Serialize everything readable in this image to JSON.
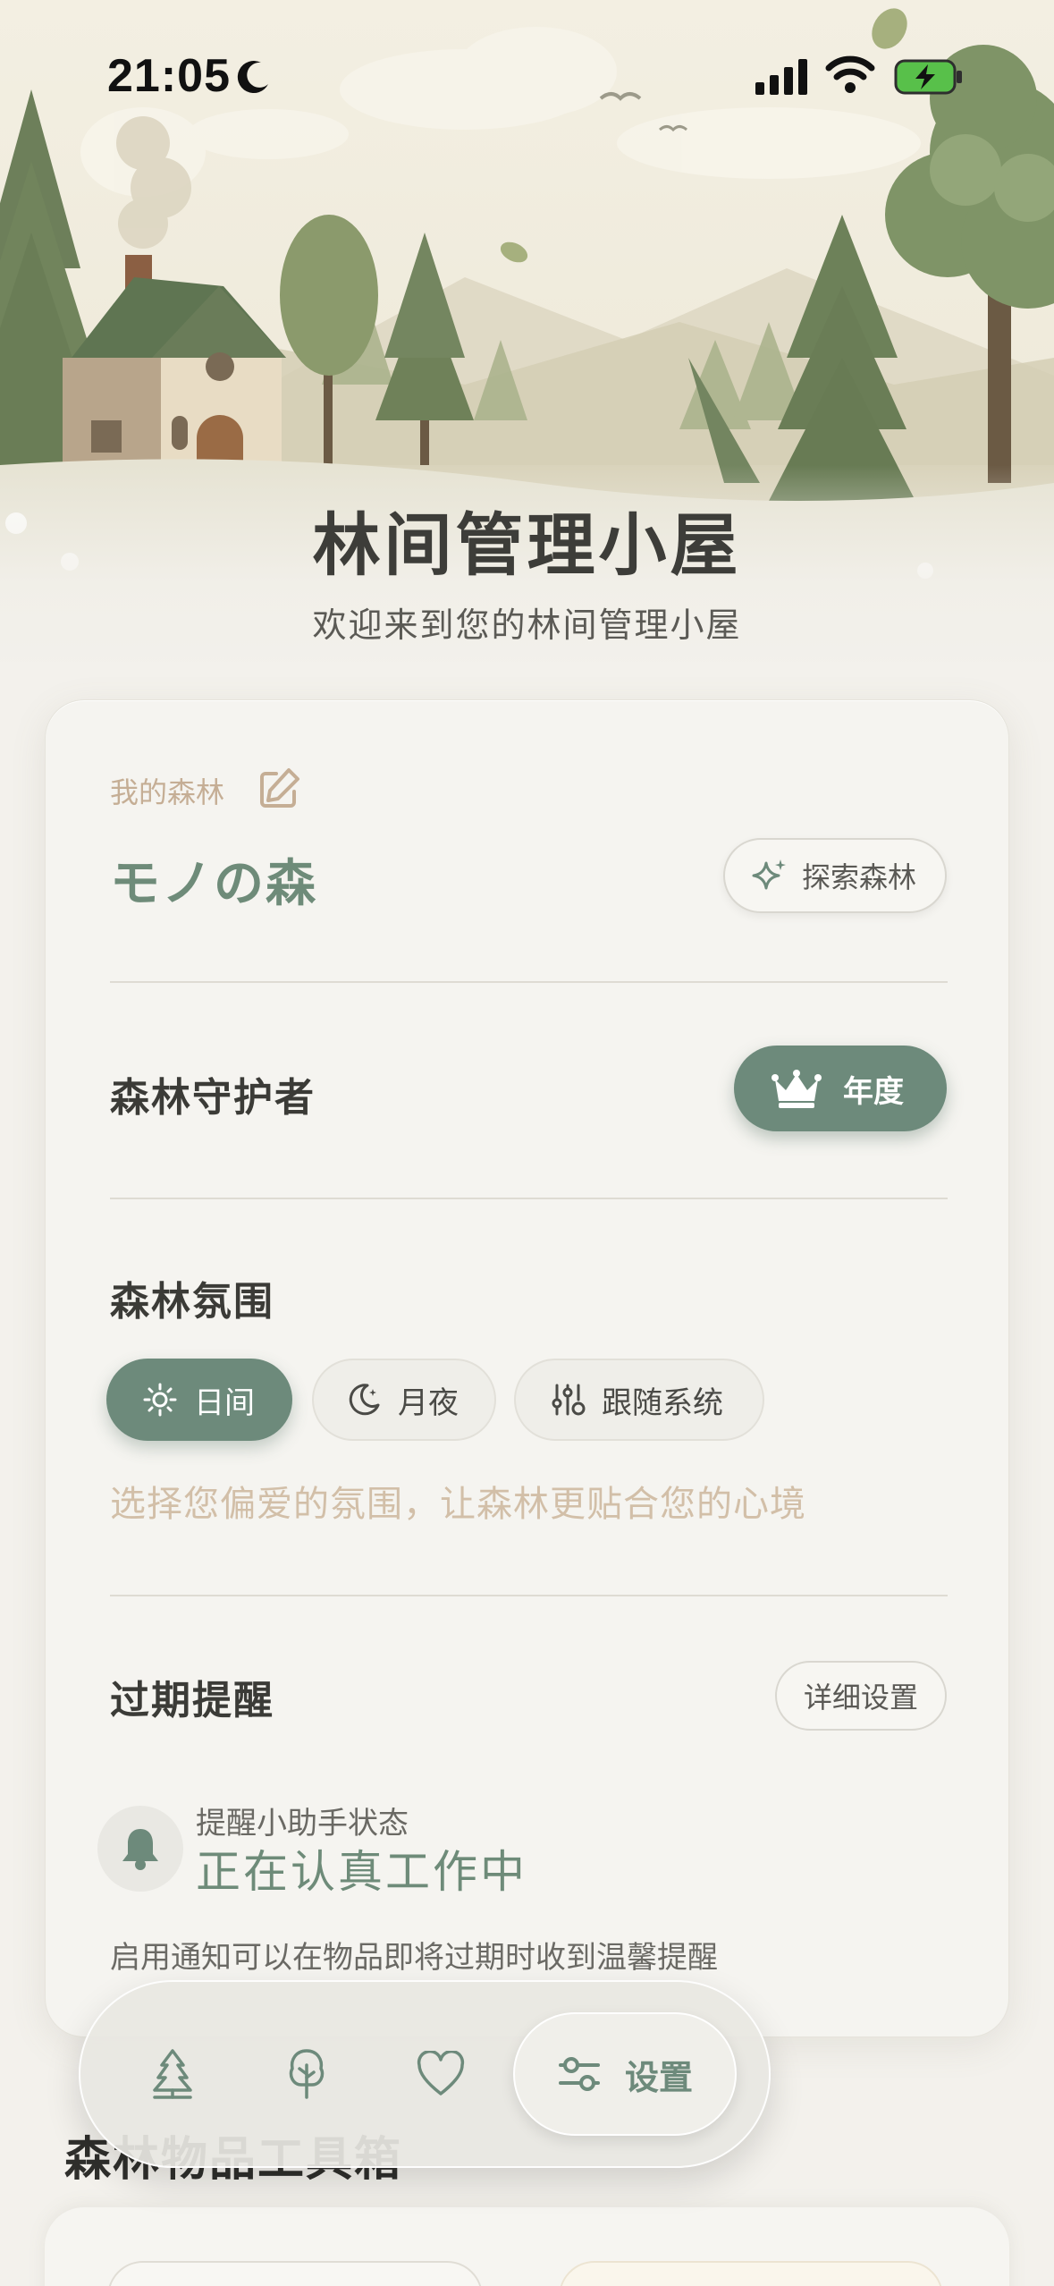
{
  "status_bar": {
    "time": "21:05"
  },
  "header": {
    "title": "林间管理小屋",
    "subtitle": "欢迎来到您的林间管理小屋"
  },
  "forest": {
    "label": "我的森林",
    "name": "モノの森",
    "explore_button": "探索森林"
  },
  "guardian": {
    "title": "森林守护者",
    "plan_badge": "年度"
  },
  "atmosphere": {
    "title": "森林氛围",
    "options": [
      {
        "label": "日间",
        "icon": "sun-icon",
        "selected": true
      },
      {
        "label": "月夜",
        "icon": "moon-icon",
        "selected": false
      },
      {
        "label": "跟随系统",
        "icon": "sliders-icon",
        "selected": false
      }
    ],
    "hint": "选择您偏爱的氛围，让森林更贴合您的心境"
  },
  "expiry": {
    "title": "过期提醒",
    "settings_button": "详细设置",
    "assistant_label": "提醒小助手状态",
    "assistant_status": "正在认真工作中",
    "notice": "启用通知可以在物品即将过期时收到温馨提醒"
  },
  "below": {
    "section_title": "森林物品工具箱"
  },
  "tabbar": {
    "tabs": [
      {
        "icon": "trees-icon"
      },
      {
        "icon": "tree-icon"
      },
      {
        "icon": "heart-icon"
      },
      {
        "icon": "sliders-icon",
        "label": "设置",
        "active": true
      }
    ]
  },
  "colors": {
    "accent": "#6d8a7b",
    "hint": "#d2bfa8",
    "background": "#f3f1ec"
  }
}
